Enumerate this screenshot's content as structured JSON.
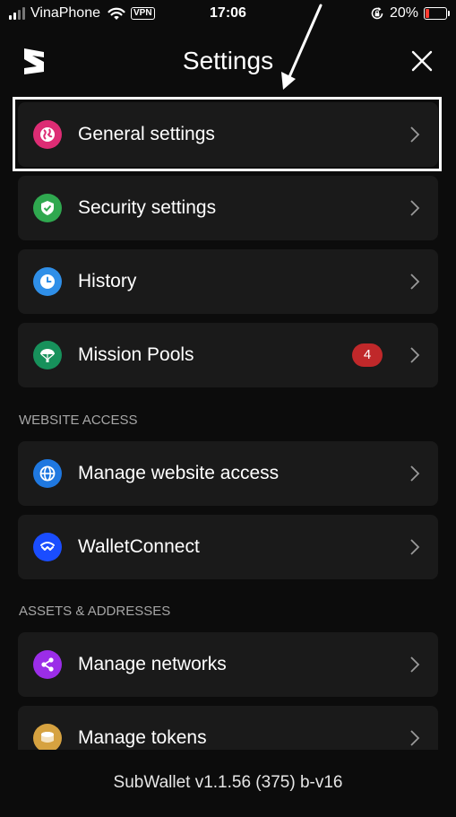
{
  "status_bar": {
    "carrier": "VinaPhone",
    "vpn": "VPN",
    "time": "17:06",
    "battery": "20%"
  },
  "header": {
    "title": "Settings"
  },
  "items": [
    {
      "label": "General settings",
      "icon": "globe-icon",
      "color": "#dd2c74"
    },
    {
      "label": "Security settings",
      "icon": "shield-check-icon",
      "color": "#2fa84f"
    },
    {
      "label": "History",
      "icon": "clock-icon",
      "color": "#2f8fe8"
    },
    {
      "label": "Mission Pools",
      "icon": "parachute-icon",
      "color": "#17915b",
      "badge": "4"
    },
    {
      "label": "Manage website access",
      "icon": "globe-icon",
      "color": "#1f78e0"
    },
    {
      "label": "WalletConnect",
      "icon": "walletconnect-icon",
      "color": "#1a4dff"
    },
    {
      "label": "Manage networks",
      "icon": "share-network-icon",
      "color": "#9b2de8"
    },
    {
      "label": "Manage tokens",
      "icon": "coins-icon",
      "color": "#d6a240"
    }
  ],
  "sections": {
    "website_access": "WEBSITE ACCESS",
    "assets_addresses": "ASSETS & ADDRESSES"
  },
  "footer": {
    "version": "SubWallet v1.1.56 (375) b-v16"
  }
}
